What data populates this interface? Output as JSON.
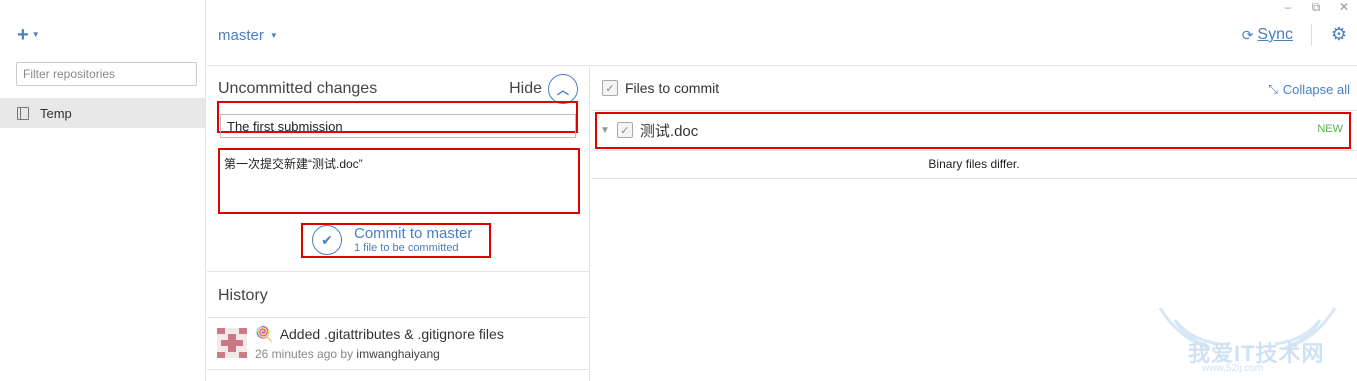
{
  "window_controls": {
    "minimize": "–",
    "restore": "⧉",
    "close": "✕"
  },
  "sidebar": {
    "add_label": "+",
    "filter_placeholder": "Filter repositories",
    "repos": [
      {
        "label": "Temp"
      }
    ]
  },
  "topbar": {
    "branch": "master",
    "sync_label": "Sync"
  },
  "changes": {
    "title": "Uncommitted changes",
    "hide_label": "Hide",
    "summary_value": "The first submission",
    "description_value": "第一次提交新建“测试.doc”",
    "commit_label": "Commit to master",
    "commit_sub": "1 file to be committed"
  },
  "history": {
    "title": "History",
    "items": [
      {
        "message": "Added .gitattributes & .gitignore files",
        "time": "26 minutes ago by",
        "author": "imwanghaiyang"
      }
    ]
  },
  "files": {
    "header_label": "Files to commit",
    "collapse_label": "Collapse all",
    "items": [
      {
        "name": "测试.doc",
        "status": "NEW",
        "diff_note": "Binary files differ."
      }
    ]
  },
  "watermark": {
    "text": "我爱IT技术网",
    "url": "www.52ij.com"
  },
  "colors": {
    "accent": "#4a7fc1",
    "highlight": "#e00000",
    "new_badge": "#52b34a"
  }
}
